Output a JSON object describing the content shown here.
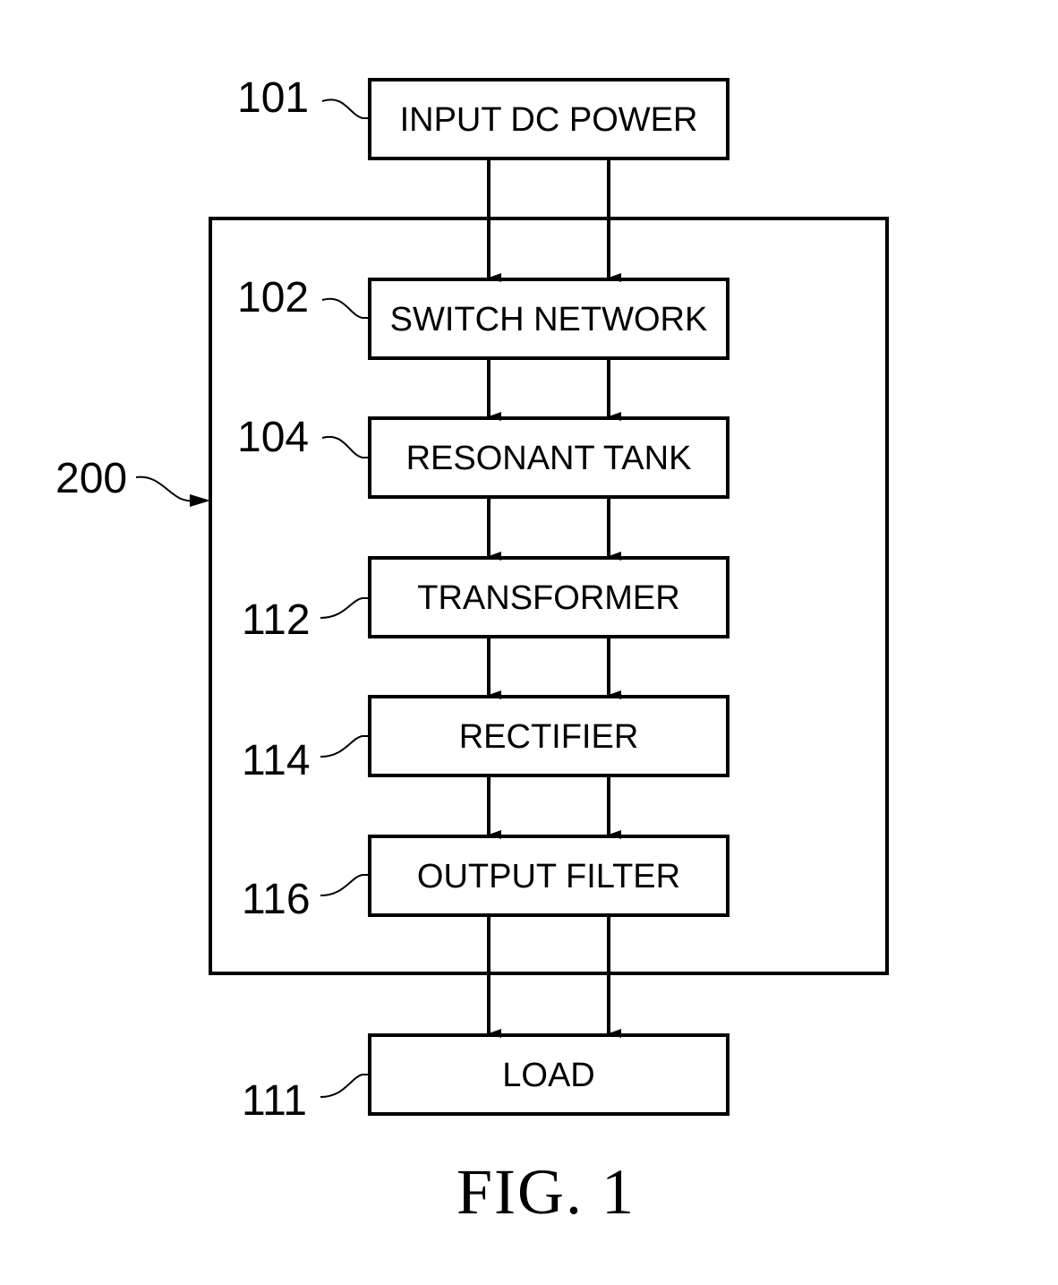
{
  "diagram": {
    "figure_title": "FIG. 1",
    "container": {
      "ref": "200"
    },
    "blocks": [
      {
        "id": "input-dc-power",
        "label": "INPUT DC POWER",
        "ref": "101"
      },
      {
        "id": "switch-network",
        "label": "SWITCH NETWORK",
        "ref": "102"
      },
      {
        "id": "resonant-tank",
        "label": "RESONANT TANK",
        "ref": "104"
      },
      {
        "id": "transformer",
        "label": "TRANSFORMER",
        "ref": "112"
      },
      {
        "id": "rectifier",
        "label": "RECTIFIER",
        "ref": "114"
      },
      {
        "id": "output-filter",
        "label": "OUTPUT FILTER",
        "ref": "116"
      },
      {
        "id": "load",
        "label": "LOAD",
        "ref": "111"
      }
    ],
    "connections": [
      {
        "from": "input-dc-power",
        "to": "switch-network",
        "lines": 2
      },
      {
        "from": "switch-network",
        "to": "resonant-tank",
        "lines": 2
      },
      {
        "from": "resonant-tank",
        "to": "transformer",
        "lines": 2
      },
      {
        "from": "transformer",
        "to": "rectifier",
        "lines": 2
      },
      {
        "from": "rectifier",
        "to": "output-filter",
        "lines": 2
      },
      {
        "from": "output-filter",
        "to": "load",
        "lines": 2
      }
    ]
  }
}
